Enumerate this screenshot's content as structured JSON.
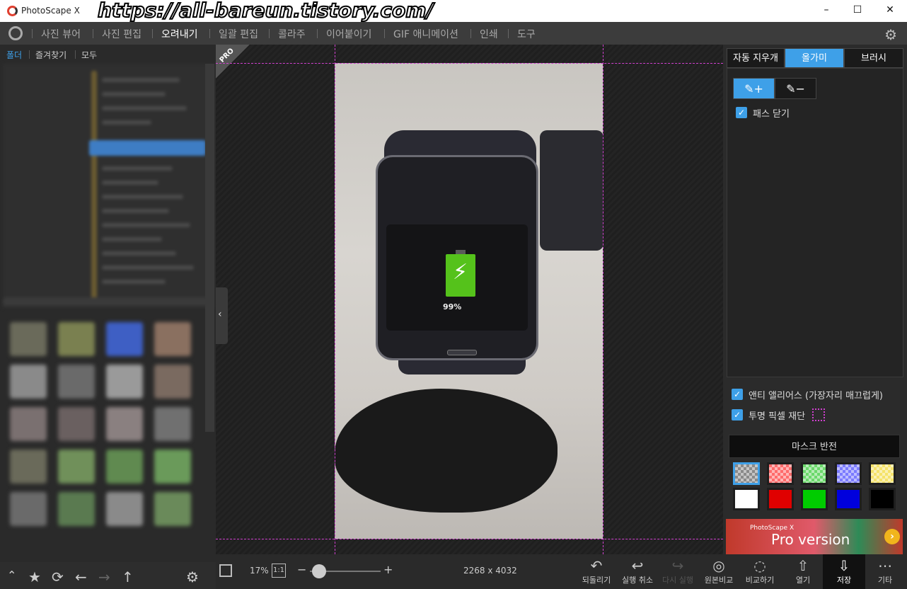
{
  "window": {
    "title": "PhotoScape X",
    "watermark": "https://all-bareun.tistory.com/",
    "minimize": "–",
    "maximize": "☐",
    "close": "✕"
  },
  "menu": {
    "items": [
      {
        "label": "사진 뷰어"
      },
      {
        "label": "사진 편집"
      },
      {
        "label": "오려내기"
      },
      {
        "label": "일괄 편집"
      },
      {
        "label": "콜라주"
      },
      {
        "label": "이어붙이기"
      },
      {
        "label": "GIF 애니메이션"
      },
      {
        "label": "인쇄"
      },
      {
        "label": "도구"
      }
    ],
    "active": "오려내기"
  },
  "left_panel": {
    "tabs": [
      {
        "label": "폴더"
      },
      {
        "label": "즐겨찾기"
      },
      {
        "label": "모두"
      }
    ]
  },
  "canvas": {
    "pro_badge": "PRO",
    "battery_percent": "99%"
  },
  "right_panel": {
    "tabs": [
      {
        "label": "자동 지우개"
      },
      {
        "label": "올가미"
      },
      {
        "label": "브러시"
      }
    ],
    "close_path_label": "패스 닫기",
    "anti_alias_label": "앤티 앨리어스 (가장자리 매끄럽게)",
    "trim_transparent_label": "투명 픽셀 재단",
    "mask_invert_label": "마스크 반전",
    "swatch_colors": [
      "#ff6b6b",
      "#6bd96b",
      "#7b7bff",
      "#f5e36b",
      "#ffffff",
      "#e00000",
      "#00cc00",
      "#0000dd",
      "#000000"
    ],
    "banner_small": "PhotoScape X",
    "banner_big": "Pro version"
  },
  "bottom_bar": {
    "zoom": "17%",
    "one_to_one": "1:1",
    "dimensions": "2268 x 4032",
    "actions": [
      {
        "label": "되돌리기"
      },
      {
        "label": "실행 취소"
      },
      {
        "label": "다시 실행"
      },
      {
        "label": "원본비교"
      },
      {
        "label": "비교하기"
      },
      {
        "label": "열기"
      },
      {
        "label": "저장"
      },
      {
        "label": "기타"
      }
    ]
  }
}
